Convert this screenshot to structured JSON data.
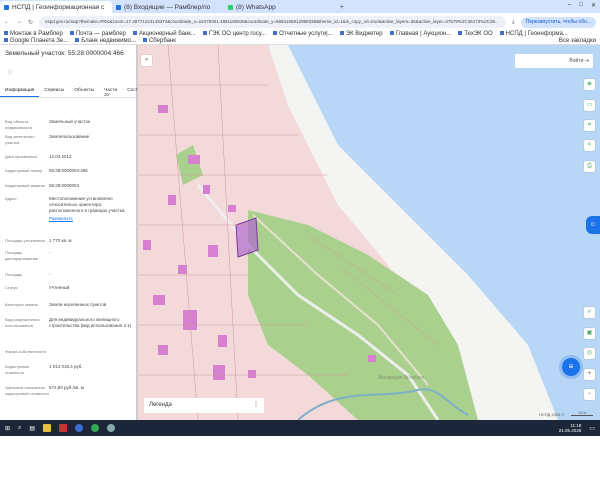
{
  "browser": {
    "tabs": [
      {
        "label": "НСПД | Геоинформационная с"
      },
      {
        "label": "(8) Входящие — Рамблер/по"
      },
      {
        "label": "(8) WhatsApp"
      }
    ],
    "url": "nspd.gov.ru/map?thematic=PKK&zoom=17.48771224149374&coordinate_x=16478301.4891190948&coordinate_y=5684166912988338&theme_id=1&is_copy_url=true&active_layers=36&active_layer=37579%2C36473%2C36...",
    "update_button": "Перезапустить, чтобы обн...",
    "bookmarks": [
      "Монтаж в Рамблер",
      "Почта — рамблер",
      "Акционерный банк...",
      "ГЭК ОО центр госу...",
      "Отчетные услуги|...",
      "ЭК Виджетер",
      "Главная | Аукцион...",
      "ТехЭК ОО",
      "НСПД | Геоинформа...",
      "Google Планета Зе...",
      "Бланк недвижимо...",
      "Сбербанк"
    ],
    "bookmarks_folder": "Все закладки"
  },
  "panel": {
    "title": "Земельный участок: 55:28:0000004:466",
    "tabs": [
      "Информация",
      "Сервисы",
      "Объекты",
      "Части ЗУ",
      "Сост"
    ],
    "fields": [
      {
        "key": "Вид объекта недвижимости",
        "value": "Земельный участок"
      },
      {
        "key": "Вид земельного участка",
        "value": "Землепользование"
      },
      {
        "key": "Дата присвоения",
        "value": "12.04.2012"
      },
      {
        "key": "Кадастровый номер",
        "value": "55:28:0000004:466"
      },
      {
        "key": "Кадастровый квартал",
        "value": "55:28:0000004"
      },
      {
        "key": "Адрес",
        "value": "Местоположение установлено относительно ориентира, расположенного в границах участка."
      },
      {
        "key": "Площадь уточненная",
        "value": "1 770 кв. м"
      },
      {
        "key": "Площадь декларированная",
        "value": "-"
      },
      {
        "key": "Площадь",
        "value": "-"
      },
      {
        "key": "Статус",
        "value": "Учтенный"
      },
      {
        "key": "Категория земель",
        "value": "Земли населенных пунктов"
      },
      {
        "key": "Вид разрешенного использования",
        "value": "Для индивидуального жилищного строительства (вид использования 2.1)"
      },
      {
        "key": "Форма собственности",
        "value": ""
      },
      {
        "key": "Кадастровая стоимость",
        "value": "1 014 016,4 руб."
      },
      {
        "key": "Удельный показатель кадастровой стоимости",
        "value": "572,83 руб./кв. м"
      }
    ],
    "expand_link": "Развернуть"
  },
  "map": {
    "tools_label": "Войти",
    "legend_label": "Легенда",
    "attribution": "НСПД 2025 ©",
    "scale": "10 м",
    "watermark": "Активация Windows",
    "colors": {
      "water": "#b8d6f6",
      "urban": "#f3d9d9",
      "green": "#a9d08c",
      "selected": "#b06ad0"
    }
  },
  "taskbar": {
    "time": "11:18",
    "date": "21.05.2025"
  }
}
